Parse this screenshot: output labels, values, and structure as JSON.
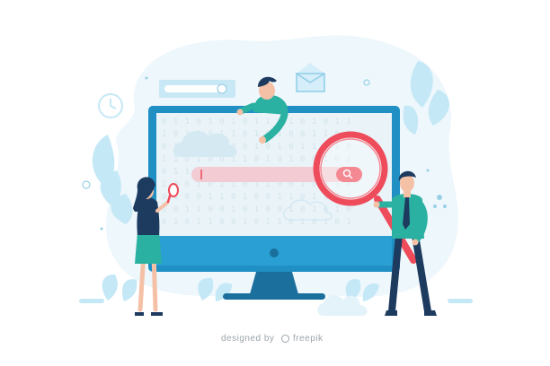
{
  "illustration": {
    "binary_rows": [
      "0 1 1 0 1 0 1 0 1 1 0 1 0 1 0 1 1",
      "1 0 1 0 0 1 1 0 1 0 1 0 0 1 1 0 0",
      "0 1 0 1 0 1 0 0 1 0 1 0 1 1 0 1 0",
      "1 1 0 1 0 0 1 1 0 1 0 1 0 0 1 0 1",
      "0 1 1 0 1 0 1 0 0 1 1 0 0 1 0 1 1",
      "1 0 0 1 0 1 1 0 1 1 0 0 1 0 0 1 0",
      "0 1 0 0 1 1 0 1 0 0 1 1 0 1 1 0 1",
      "1 0 1 1 0 0 1 0 1 0 0 1 0 1 0 1 0",
      "0 1 0 1 1 0 0 1 0 1 1 0 1 0 1 0 1"
    ],
    "colors": {
      "blob": "#edf7fc",
      "leaf": "#c5e8f6",
      "monitor_frame": "#1f8fc4",
      "monitor_dark": "#1a6f9c",
      "screen": "#e9f3f8",
      "search_bar": "#f2cbd3",
      "search_accent": "#ee4b5b",
      "skin": "#f5c1a6",
      "teal_shirt": "#2ab1a1",
      "navy": "#1d3a5f"
    }
  },
  "credits": {
    "designer": "designed by",
    "freepik": "freepik"
  }
}
